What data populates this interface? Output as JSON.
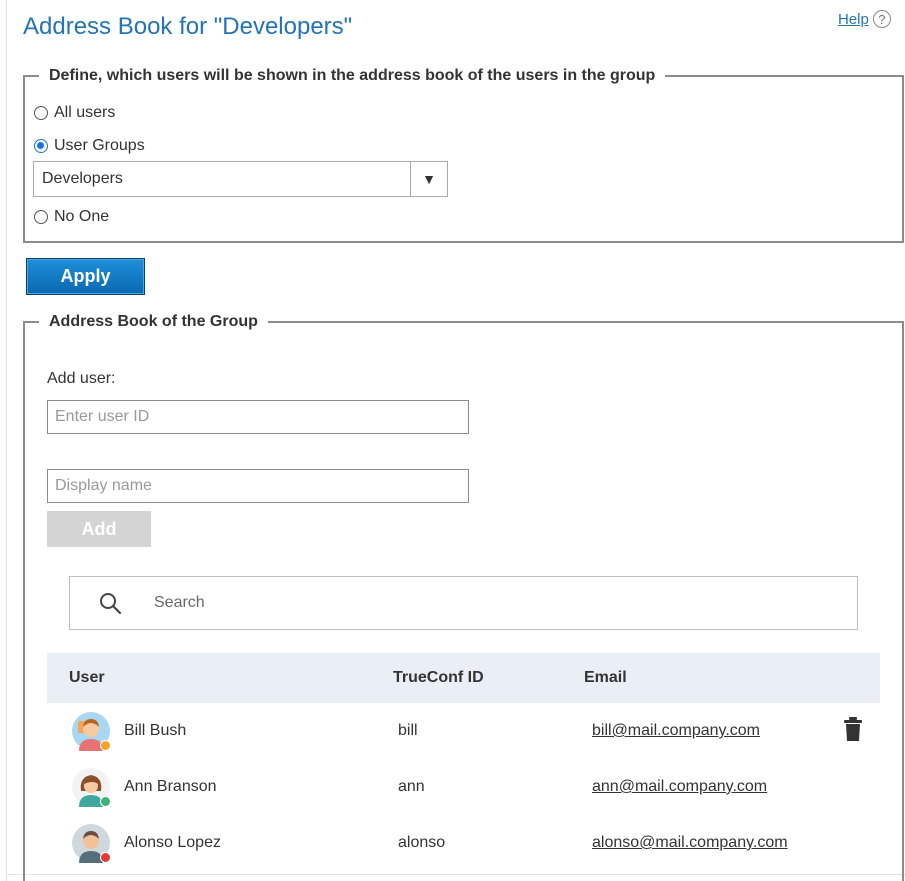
{
  "page": {
    "title": "Address Book for \"Developers\"",
    "help_label": "Help",
    "help_icon": "?"
  },
  "visibility": {
    "legend": "Define, which users will be shown in the address book of the users in the group",
    "options": [
      {
        "label": "All users",
        "checked": false
      },
      {
        "label": "User Groups",
        "checked": true
      },
      {
        "label": "No One",
        "checked": false
      }
    ],
    "group_select": {
      "value": "Developers",
      "arrow": "▼"
    },
    "apply_label": "Apply"
  },
  "address_book": {
    "legend": "Address Book of the Group",
    "add_user_label": "Add user:",
    "user_id_placeholder": "Enter user ID",
    "display_name_placeholder": "Display name",
    "add_label": "Add",
    "search_placeholder": "Search",
    "columns": [
      "User",
      "TrueConf ID",
      "Email"
    ],
    "rows": [
      {
        "name": "Bill Bush",
        "id": "bill",
        "email": "bill@mail.company.com",
        "status_color": "#f5a623",
        "avatar": "male-avatar-icon"
      },
      {
        "name": "Ann Branson",
        "id": "ann",
        "email": "ann@mail.company.com",
        "status_color": "#3cb371",
        "avatar": "female-avatar-icon"
      },
      {
        "name": "Alonso Lopez",
        "id": "alonso",
        "email": "alonso@mail.company.com",
        "status_color": "#e53935",
        "avatar": "male-avatar-icon"
      }
    ]
  },
  "colors": {
    "accent": "#2474b5",
    "apply_bg": "#0a69b2",
    "header_bg": "#eaeff5"
  }
}
